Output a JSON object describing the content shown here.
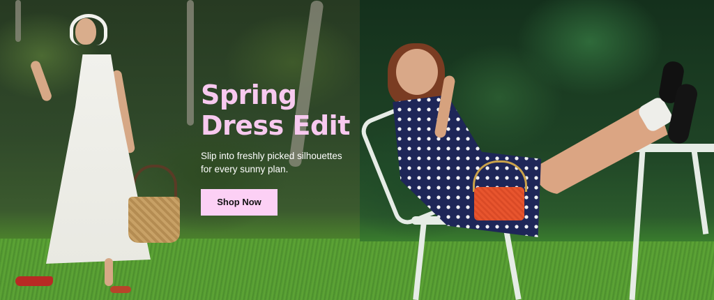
{
  "banner": {
    "headline_line1": "Spring",
    "headline_line2": "Dress Edit",
    "subcopy_line1": "Slip into freshly picked silhouettes",
    "subcopy_line2": "for every sunny plan.",
    "cta_label": "Shop Now"
  },
  "colors": {
    "headline": "#f7c9ef",
    "cta_background": "#fcd0f5",
    "cta_text": "#111111",
    "subcopy": "#ffffff"
  }
}
